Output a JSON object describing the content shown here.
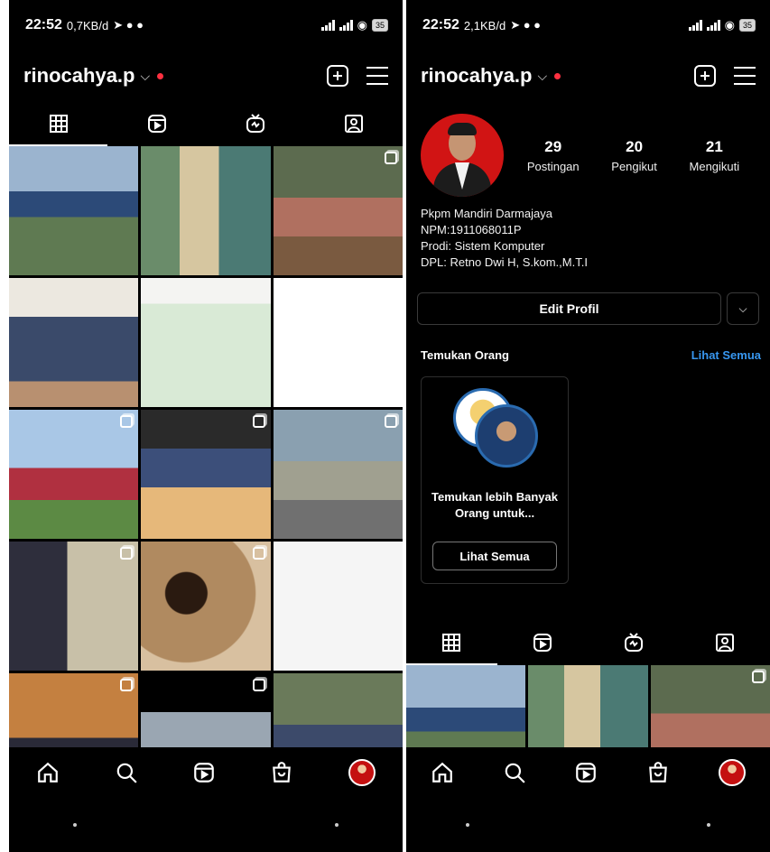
{
  "left": {
    "status": {
      "time": "22:52",
      "speed": "0,7KB/d",
      "battery": "35"
    },
    "username": "rinocahya.p"
  },
  "right": {
    "status": {
      "time": "22:52",
      "speed": "2,1KB/d",
      "battery": "35"
    },
    "username": "rinocahya.p",
    "stats": [
      {
        "num": "29",
        "label": "Postingan"
      },
      {
        "num": "20",
        "label": "Pengikut"
      },
      {
        "num": "21",
        "label": "Mengikuti"
      }
    ],
    "bio": [
      "Pkpm Mandiri Darmajaya",
      "NPM:1911068011P",
      "Prodi: Sistem Komputer",
      "DPL: Retno Dwi H, S.kom.,M.T.I"
    ],
    "edit_profile": "Edit Profil",
    "discover_title": "Temukan Orang",
    "see_all": "Lihat Semua",
    "suggest_text": "Temukan lebih Banyak Orang untuk...",
    "suggest_button": "Lihat Semua"
  },
  "icons": {
    "tabs": [
      "grid-icon",
      "reels-icon",
      "igtv-icon",
      "tagged-icon"
    ],
    "nav": [
      "home-icon",
      "search-icon",
      "reels-icon",
      "shop-icon",
      "profile-avatar"
    ]
  },
  "colors": {
    "background": "#000000",
    "accent": "#3897f0",
    "notification": "#ff3040"
  },
  "grid_photos": [
    {
      "bg": "linear-gradient(#9bb4cf 0 35%, #2c4a78 35% 55%, #5f7a52 55% 100%)",
      "multi": false
    },
    {
      "bg": "linear-gradient(90deg, #6a8c6a 0 30%, #d6c6a0 30% 60%, #4b7a74 60% 100%)",
      "multi": false
    },
    {
      "bg": "linear-gradient(#5c6b4f 0 40%, #b07060 40% 70%, #7a5a40 70% 100%)",
      "multi": true
    },
    {
      "bg": "linear-gradient(#ece8e0 0 30%, #3a4a6a 30% 80%, #b89070 80% 100%)",
      "multi": false
    },
    {
      "bg": "linear-gradient(#f4f4f2 0 20%, #d9ead6 20% 100%)",
      "multi": false
    },
    {
      "bg": "linear-gradient(#ffffff 0 100%)",
      "multi": false
    },
    {
      "bg": "linear-gradient(#a9c7e6 0 45%, #b03040 45% 70%, #5c8a44 70% 100%)",
      "multi": true
    },
    {
      "bg": "linear-gradient(#2a2a2a 0 30%, #3c4f7a 30% 60%, #e6b87a 60% 100%)",
      "multi": true
    },
    {
      "bg": "linear-gradient(#8aa0b0 0 40%, #a0a090 40% 70%, #707070 70% 100%)",
      "multi": true
    },
    {
      "bg": "linear-gradient(90deg, #2e2e3c 0 45%, #c8c0a8 45% 100%)",
      "multi": true
    },
    {
      "bg": "radial-gradient(circle at 35% 40%, #2a1a10 0 18%, #b08a60 19% 60%, #d8c0a0 61% 100%)",
      "multi": true
    },
    {
      "bg": "linear-gradient(#f5f5f5 0 100%)",
      "multi": false
    },
    {
      "bg": "linear-gradient(#c48040 0 50%, #2a2a38 50% 100%)",
      "multi": true
    },
    {
      "bg": "linear-gradient(#000 0 30%, #9aa6b2 30% 100%)",
      "multi": true
    },
    {
      "bg": "linear-gradient(#6a7a5a 0 40%, #3c4a6a 40% 100%)",
      "multi": false
    }
  ],
  "grid_photos_right": [
    {
      "bg": "linear-gradient(#9bb4cf 0 35%, #2c4a78 35% 55%, #5f7a52 55% 100%)",
      "multi": false
    },
    {
      "bg": "linear-gradient(90deg, #6a8c6a 0 30%, #d6c6a0 30% 60%, #4b7a74 60% 100%)",
      "multi": false
    },
    {
      "bg": "linear-gradient(#5c6b4f 0 40%, #b07060 40% 70%, #7a5a40 70% 100%)",
      "multi": true
    }
  ]
}
